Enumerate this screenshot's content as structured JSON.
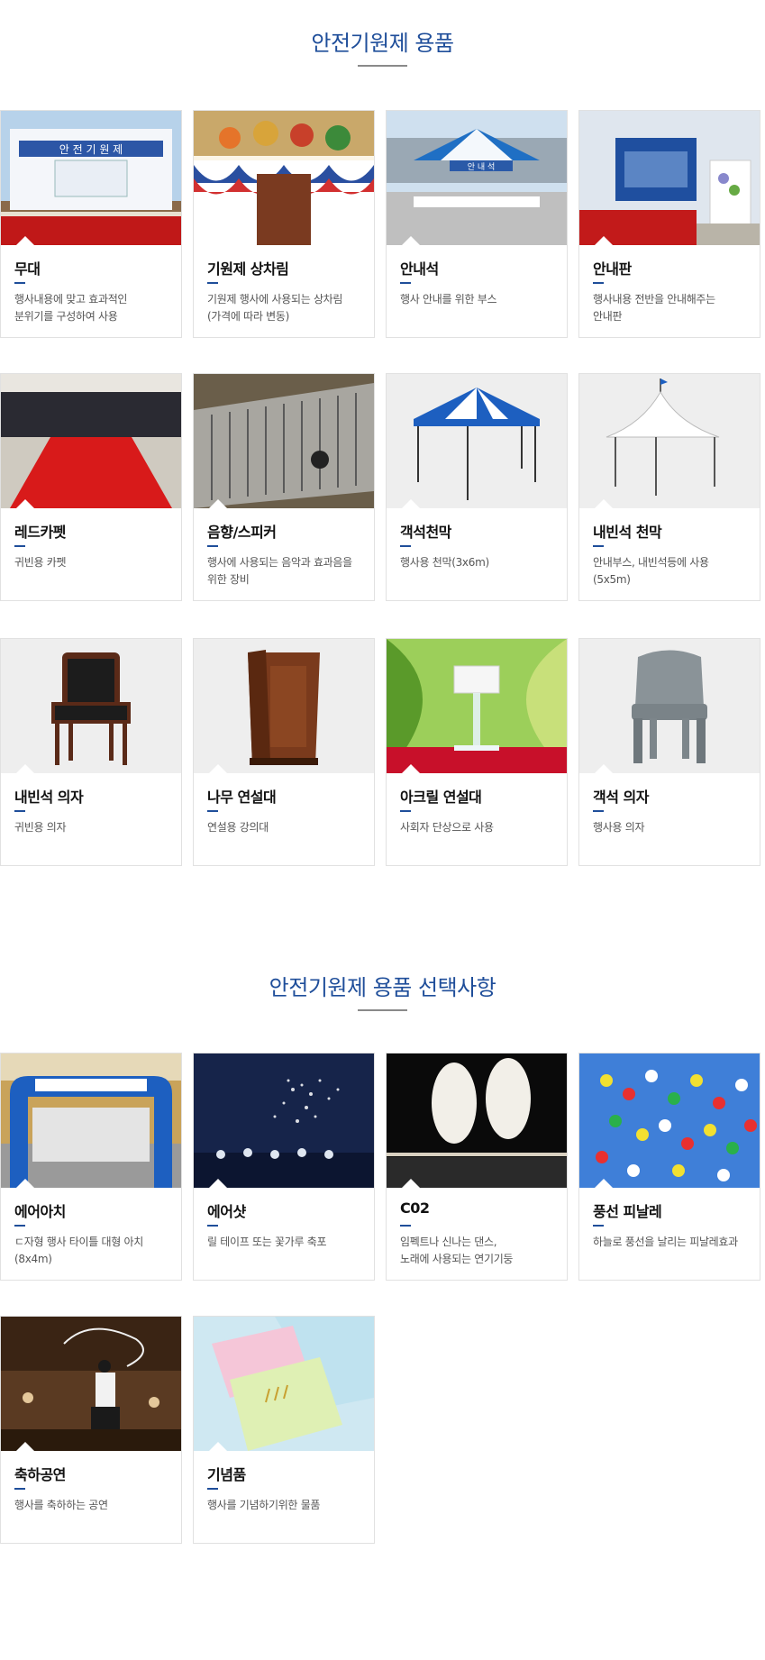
{
  "section1": {
    "title": "안전기원제 용품",
    "items": [
      {
        "name": "무대",
        "desc": "행사내용에 맞고 효과적인\n분위기를 구성하여 사용",
        "image": "stage-photo"
      },
      {
        "name": "기원제 상차림",
        "desc": "기원제 행사에 사용되는 상차림\n(가격에 따라 변동)",
        "image": "ritual-table-photo"
      },
      {
        "name": "안내석",
        "desc": "행사 안내를 위한 부스",
        "image": "info-booth-photo"
      },
      {
        "name": "안내판",
        "desc": "행사내용 전반을 안내해주는\n안내판",
        "image": "info-board-photo"
      },
      {
        "name": "레드카펫",
        "desc": "귀빈용 카펫",
        "image": "red-carpet-photo"
      },
      {
        "name": "음향/스피커",
        "desc": "행사에 사용되는 음악과 효과음을\n위한 장비",
        "image": "sound-mixer-photo"
      },
      {
        "name": "객석천막",
        "desc": "행사용 천막(3x6m)",
        "image": "audience-tent-photo"
      },
      {
        "name": "내빈석 천막",
        "desc": "안내부스, 내빈석등에 사용\n(5x5m)",
        "image": "guest-tent-photo"
      },
      {
        "name": "내빈석 의자",
        "desc": "귀빈용 의자",
        "image": "guest-chair-photo"
      },
      {
        "name": "나무 연설대",
        "desc": "연설용 강의대",
        "image": "wood-podium-photo"
      },
      {
        "name": "아크릴 연설대",
        "desc": "사회자 단상으로 사용",
        "image": "acrylic-podium-photo"
      },
      {
        "name": "객석 의자",
        "desc": "행사용 의자",
        "image": "plastic-chair-photo"
      }
    ],
    "banner_text": "안 전 기 원 제",
    "booth_text": "안 내 석"
  },
  "section2": {
    "title": "안전기원제 용품 선택사항",
    "items": [
      {
        "name": "에어아치",
        "desc": "ㄷ자형 행사 타이틀 대형 아치\n(8x4m)",
        "image": "air-arch-photo"
      },
      {
        "name": "에어샷",
        "desc": "릴 테이프 또는 꽃가루 축포",
        "image": "air-shot-photo"
      },
      {
        "name": "C02",
        "desc": "임펙트나 신나는 댄스,\n노래에 사용되는 연기기둥",
        "image": "co2-jet-photo"
      },
      {
        "name": "풍선 피날레",
        "desc": "하늘로 풍선을 날리는 피날레효과",
        "image": "balloon-photo"
      },
      {
        "name": "축하공연",
        "desc": "행사를 축하하는 공연",
        "image": "performance-photo"
      },
      {
        "name": "기념품",
        "desc": "행사를 기념하기위한 물품",
        "image": "towel-gift-photo"
      }
    ]
  },
  "colors": {
    "accent": "#1f4e9a",
    "border": "#e1e1e1"
  }
}
